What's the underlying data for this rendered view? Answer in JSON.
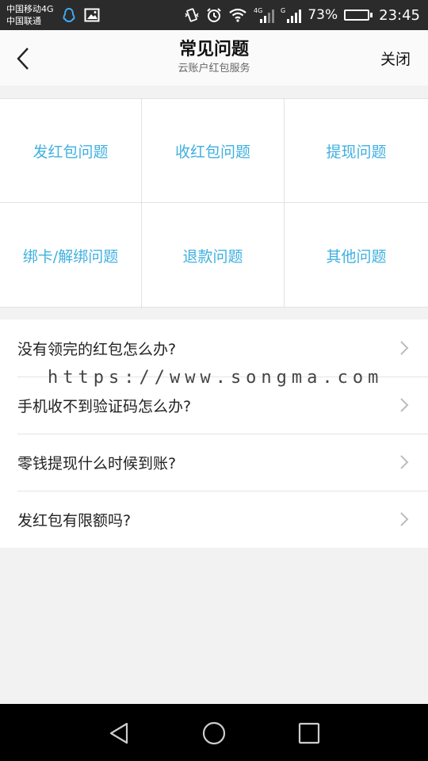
{
  "status_bar": {
    "carrier_1": "中国移动4G",
    "carrier_2": "中国联通",
    "network_label": "4G",
    "network_label_2": "G",
    "battery": "73%",
    "battery_level": 0.73,
    "time": "23:45"
  },
  "header": {
    "title": "常见问题",
    "subtitle": "云账户红包服务",
    "close_label": "关闭"
  },
  "categories": [
    "发红包问题",
    "收红包问题",
    "提现问题",
    "绑卡/解绑问题",
    "退款问题",
    "其他问题"
  ],
  "faq": [
    "没有领完的红包怎么办?",
    "手机收不到验证码怎么办?",
    "零钱提现什么时候到账?",
    "发红包有限额吗?"
  ],
  "watermark": "https://www.songma.com",
  "colors": {
    "accent": "#3fb0e0",
    "battery": "#57c23a"
  }
}
